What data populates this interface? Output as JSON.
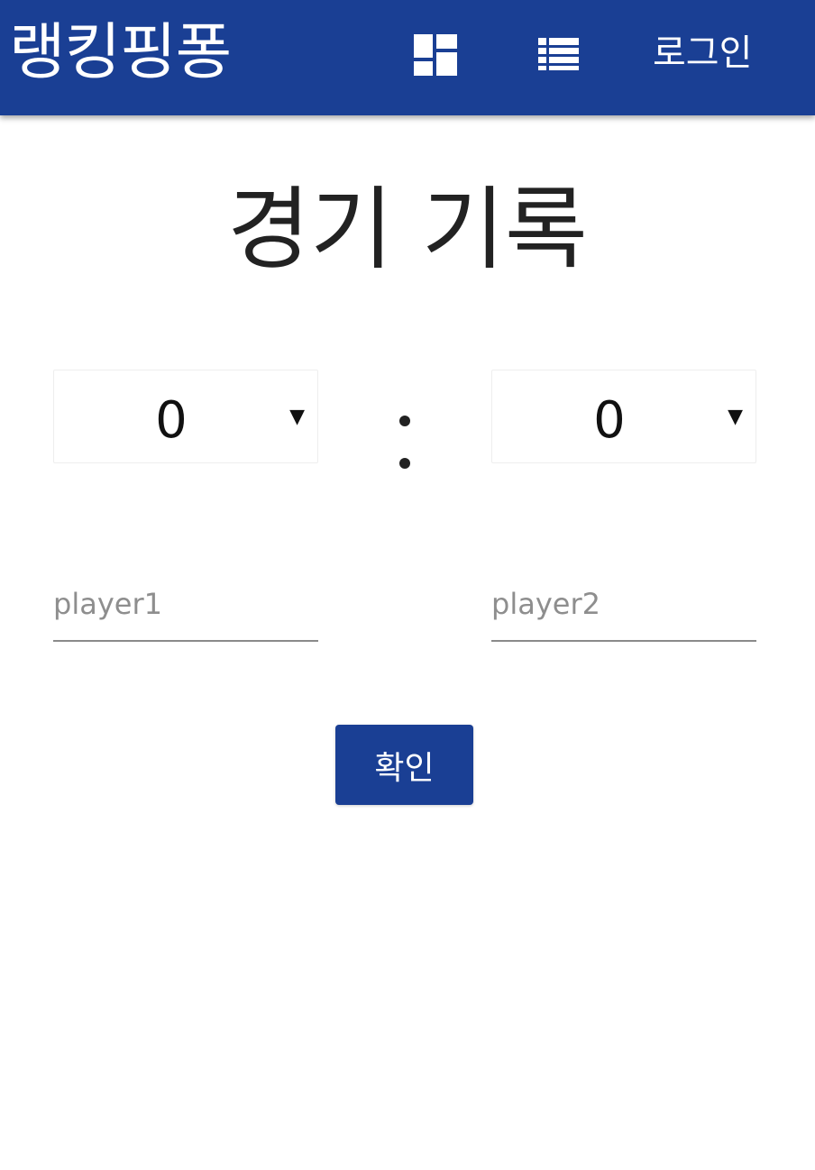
{
  "appbar": {
    "title": "랭킹핑퐁",
    "dashboard_icon": "dashboard-icon",
    "list_icon": "view-list-icon",
    "login_label": "로그인",
    "color": "#1a3f94"
  },
  "main": {
    "title": "경기 기록",
    "score1": {
      "value": "0",
      "icon": "arrow-drop-down-icon"
    },
    "separator": ":",
    "score2": {
      "value": "0",
      "icon": "arrow-drop-down-icon"
    },
    "player1": {
      "placeholder": "player1",
      "value": ""
    },
    "player2": {
      "placeholder": "player2",
      "value": ""
    },
    "confirm_label": "확인"
  }
}
